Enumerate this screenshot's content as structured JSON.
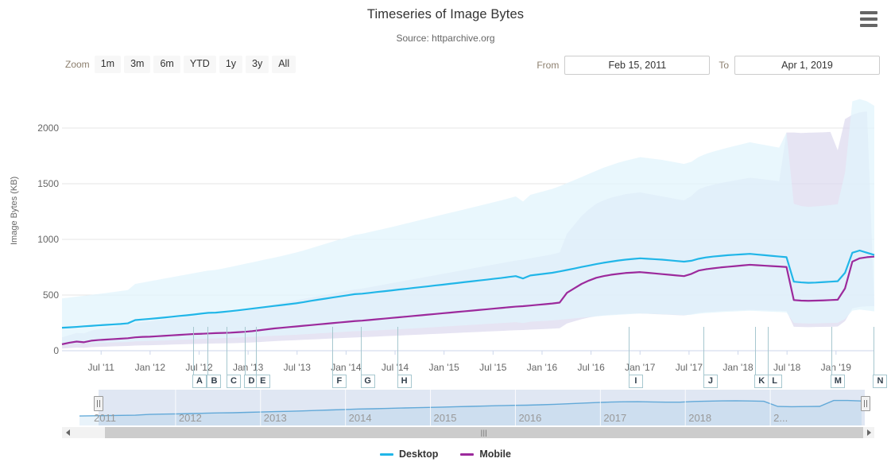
{
  "header": {
    "title": "Timeseries of Image Bytes",
    "subtitle": "Source: httparchive.org",
    "menu_icon": "hamburger-menu-icon"
  },
  "range_selector": {
    "zoom_label": "Zoom",
    "buttons": [
      "1m",
      "3m",
      "6m",
      "YTD",
      "1y",
      "3y",
      "All"
    ],
    "from_label": "From",
    "from_value": "Feb 15, 2011",
    "to_label": "To",
    "to_value": "Apr 1, 2019"
  },
  "navigator": {
    "years": [
      "2011",
      "2012",
      "2013",
      "2014",
      "2015",
      "2016",
      "2017",
      "2018",
      "2..."
    ],
    "left_handle": "navigator-left-handle",
    "right_handle": "navigator-right-handle",
    "scrollbar_grip": "|||"
  },
  "legend": {
    "items": [
      {
        "label": "Desktop",
        "color": "#21b6e8"
      },
      {
        "label": "Mobile",
        "color": "#9c2a9c"
      }
    ]
  },
  "chart_data": {
    "type": "line",
    "title": "Timeseries of Image Bytes",
    "subtitle": "Source: httparchive.org",
    "xlabel": "",
    "ylabel": "Image Bytes (KB)",
    "ylim": [
      0,
      2250
    ],
    "yticks": [
      0,
      500,
      1000,
      1500,
      2000
    ],
    "ytick_labels": [
      "0",
      "500",
      "1000",
      "1500",
      "2000"
    ],
    "grid": true,
    "legend_position": "bottom",
    "xtick_labels": [
      "Jul '11",
      "Jan '12",
      "Jul '12",
      "Jan '13",
      "Jul '13",
      "Jan '14",
      "Jul '14",
      "Jan '15",
      "Jul '15",
      "Jan '16",
      "Jul '16",
      "Jan '17",
      "Jul '17",
      "Jan '18",
      "Jul '18",
      "Jan '19"
    ],
    "x_range": [
      "Feb 15, 2011",
      "Apr 1, 2019"
    ],
    "annotations": [
      {
        "label": "A",
        "x": 0.161
      },
      {
        "label": "B",
        "x": 0.179
      },
      {
        "label": "C",
        "x": 0.203
      },
      {
        "label": "D",
        "x": 0.225
      },
      {
        "label": "E",
        "x": 0.239
      },
      {
        "label": "F",
        "x": 0.333
      },
      {
        "label": "G",
        "x": 0.368
      },
      {
        "label": "H",
        "x": 0.413
      },
      {
        "label": "I",
        "x": 0.698
      },
      {
        "label": "J",
        "x": 0.79
      },
      {
        "label": "K",
        "x": 0.853
      },
      {
        "label": "L",
        "x": 0.869
      },
      {
        "label": "M",
        "x": 0.947
      },
      {
        "label": "N",
        "x": 0.999
      }
    ],
    "series": [
      {
        "name": "Desktop",
        "color": "#21b6e8",
        "band_color": "#e1f4fc",
        "values": [
          206,
          210,
          214,
          219,
          223,
          228,
          232,
          236,
          240,
          246,
          275,
          281,
          286,
          292,
          298,
          305,
          312,
          318,
          325,
          333,
          340,
          342,
          348,
          355,
          362,
          370,
          378,
          386,
          394,
          402,
          410,
          418,
          426,
          436,
          448,
          458,
          468,
          478,
          488,
          498,
          508,
          512,
          519,
          527,
          534,
          541,
          549,
          556,
          564,
          571,
          578,
          586,
          593,
          601,
          608,
          616,
          623,
          631,
          638,
          646,
          653,
          662,
          670,
          649,
          676,
          684,
          692,
          700,
          712,
          725,
          738,
          752,
          765,
          778,
          790,
          800,
          810,
          818,
          824,
          830,
          826,
          822,
          818,
          812,
          806,
          800,
          808,
          826,
          838,
          846,
          852,
          858,
          862,
          866,
          870,
          864,
          858,
          852,
          846,
          840,
          620,
          614,
          610,
          612,
          616,
          620,
          624,
          700,
          880,
          900,
          880,
          860
        ],
        "band_upper": [
          470,
          478,
          486,
          494,
          502,
          510,
          518,
          527,
          536,
          545,
          600,
          612,
          624,
          636,
          648,
          660,
          672,
          684,
          696,
          708,
          720,
          726,
          738,
          752,
          766,
          780,
          794,
          808,
          822,
          836,
          850,
          866,
          882,
          900,
          920,
          940,
          960,
          980,
          1000,
          1020,
          1040,
          1050,
          1065,
          1080,
          1095,
          1110,
          1126,
          1142,
          1158,
          1174,
          1190,
          1206,
          1222,
          1238,
          1254,
          1270,
          1286,
          1302,
          1318,
          1334,
          1350,
          1368,
          1386,
          1340,
          1400,
          1418,
          1436,
          1454,
          1478,
          1505,
          1532,
          1560,
          1588,
          1616,
          1644,
          1666,
          1688,
          1706,
          1722,
          1738,
          1730,
          1722,
          1714,
          1702,
          1690,
          1678,
          1696,
          1740,
          1768,
          1788,
          1806,
          1824,
          1840,
          1856,
          1872,
          1860,
          1848,
          1836,
          1824,
          1960,
          1320,
          1300,
          1292,
          1296,
          1302,
          1308,
          1316,
          1600,
          2240,
          2260,
          2240,
          2200
        ],
        "band_lower": [
          60,
          62,
          64,
          66,
          68,
          70,
          72,
          74,
          76,
          78,
          84,
          86,
          88,
          90,
          92,
          95,
          98,
          100,
          103,
          106,
          109,
          110,
          113,
          116,
          119,
          122,
          125,
          128,
          131,
          134,
          137,
          140,
          143,
          147,
          151,
          155,
          159,
          163,
          167,
          171,
          175,
          177,
          180,
          183,
          186,
          189,
          192,
          196,
          200,
          204,
          208,
          212,
          216,
          220,
          224,
          228,
          232,
          236,
          240,
          244,
          248,
          252,
          256,
          248,
          260,
          264,
          268,
          272,
          278,
          284,
          290,
          296,
          302,
          308,
          314,
          318,
          322,
          326,
          330,
          334,
          332,
          330,
          328,
          325,
          322,
          319,
          323,
          332,
          338,
          342,
          346,
          350,
          353,
          356,
          359,
          356,
          353,
          350,
          347,
          344,
          250,
          246,
          244,
          245,
          247,
          249,
          251,
          285,
          360,
          370,
          362,
          354
        ]
      },
      {
        "name": "Mobile",
        "color": "#9c2a9c",
        "band_color": "#ddd9ef",
        "values": [
          58,
          72,
          82,
          76,
          90,
          96,
          100,
          104,
          108,
          112,
          120,
          124,
          126,
          130,
          134,
          138,
          142,
          146,
          150,
          152,
          155,
          158,
          160,
          162,
          166,
          170,
          176,
          184,
          192,
          200,
          206,
          212,
          218,
          224,
          230,
          236,
          242,
          248,
          254,
          260,
          266,
          270,
          276,
          282,
          288,
          294,
          300,
          306,
          312,
          318,
          324,
          330,
          336,
          342,
          348,
          354,
          360,
          366,
          372,
          378,
          384,
          390,
          396,
          400,
          406,
          412,
          418,
          424,
          432,
          520,
          560,
          600,
          630,
          655,
          670,
          682,
          690,
          698,
          702,
          706,
          700,
          694,
          688,
          682,
          676,
          670,
          690,
          720,
          732,
          740,
          748,
          754,
          760,
          766,
          772,
          768,
          764,
          760,
          756,
          752,
          455,
          450,
          448,
          450,
          452,
          455,
          458,
          560,
          800,
          830,
          840,
          845
        ],
        "band_upper": [
          120,
          140,
          160,
          155,
          180,
          195,
          205,
          215,
          225,
          235,
          250,
          258,
          264,
          272,
          280,
          288,
          296,
          304,
          312,
          318,
          324,
          330,
          336,
          342,
          350,
          358,
          370,
          386,
          402,
          418,
          430,
          442,
          454,
          466,
          478,
          490,
          502,
          514,
          526,
          538,
          550,
          558,
          570,
          582,
          594,
          606,
          618,
          630,
          642,
          654,
          666,
          678,
          690,
          702,
          714,
          726,
          738,
          750,
          762,
          774,
          786,
          798,
          810,
          818,
          830,
          842,
          854,
          866,
          882,
          1050,
          1130,
          1210,
          1270,
          1320,
          1350,
          1374,
          1390,
          1406,
          1414,
          1422,
          1410,
          1398,
          1386,
          1374,
          1362,
          1350,
          1390,
          1450,
          1474,
          1490,
          1506,
          1518,
          1530,
          1542,
          1554,
          1546,
          1538,
          1530,
          1522,
          1960,
          1960,
          1955,
          1958,
          1960,
          1962,
          1965,
          1800,
          2080,
          2120,
          2140,
          2150
        ],
        "band_lower": [
          20,
          24,
          28,
          26,
          32,
          35,
          37,
          39,
          41,
          43,
          46,
          48,
          49,
          51,
          53,
          55,
          57,
          59,
          61,
          62,
          63,
          65,
          66,
          67,
          69,
          71,
          74,
          78,
          82,
          86,
          89,
          92,
          95,
          98,
          101,
          104,
          107,
          110,
          113,
          116,
          119,
          121,
          124,
          127,
          130,
          133,
          136,
          139,
          142,
          145,
          148,
          151,
          154,
          157,
          160,
          163,
          166,
          169,
          172,
          175,
          178,
          181,
          184,
          186,
          189,
          192,
          195,
          198,
          202,
          245,
          264,
          283,
          298,
          310,
          317,
          323,
          327,
          331,
          333,
          335,
          332,
          329,
          326,
          323,
          320,
          317,
          327,
          341,
          347,
          351,
          355,
          358,
          361,
          364,
          367,
          365,
          363,
          361,
          359,
          357,
          215,
          213,
          212,
          213,
          214,
          215,
          217,
          266,
          380,
          394,
          399,
          401
        ]
      }
    ],
    "navigator_series": {
      "name": "Desktop",
      "color": "#4e9fd4",
      "values": [
        206,
        214,
        223,
        232,
        240,
        275,
        286,
        298,
        312,
        325,
        340,
        348,
        362,
        378,
        394,
        410,
        426,
        448,
        468,
        488,
        508,
        519,
        534,
        549,
        564,
        578,
        593,
        608,
        623,
        638,
        653,
        670,
        676,
        692,
        712,
        738,
        765,
        790,
        810,
        824,
        826,
        818,
        806,
        808,
        838,
        852,
        862,
        870,
        858,
        846,
        620,
        610,
        616,
        624,
        880,
        880,
        860
      ]
    }
  }
}
